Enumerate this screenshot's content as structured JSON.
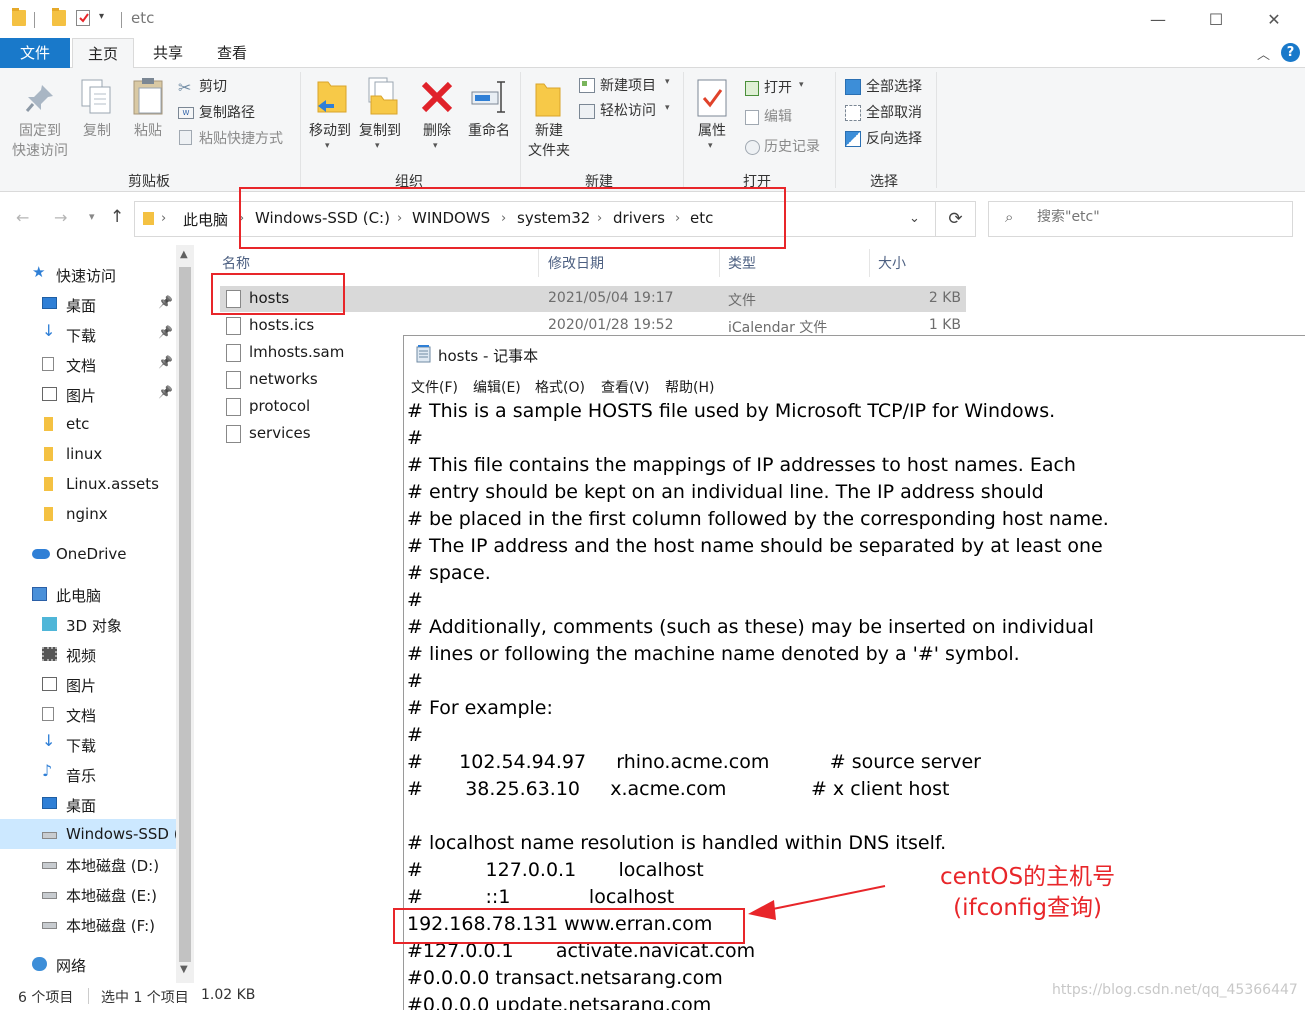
{
  "window": {
    "title": "etc",
    "minimize_glyph": "—",
    "maximize_glyph": "☐",
    "close_glyph": "✕"
  },
  "ribbon_tabs": [
    "文件",
    "主页",
    "共享",
    "查看"
  ],
  "ribbon": {
    "clipboard": {
      "label": "剪贴板",
      "pin_quick": [
        "固定到",
        "快速访问"
      ],
      "copy": "复制",
      "paste": "粘贴",
      "cut": "剪切",
      "copy_path": "复制路径",
      "paste_shortcut": "粘贴快捷方式"
    },
    "organize": {
      "label": "组织",
      "move_to": "移动到",
      "copy_to": "复制到",
      "delete": "删除",
      "rename": "重命名"
    },
    "new": {
      "label": "新建",
      "new_item": "新建项目",
      "easy_access": "轻松访问",
      "new_folder": [
        "新建",
        "文件夹"
      ]
    },
    "open": {
      "label": "打开",
      "properties": "属性",
      "open": "打开",
      "edit": "编辑",
      "history": "历史记录"
    },
    "select": {
      "label": "选择",
      "select_all": "全部选择",
      "select_none": "全部取消",
      "invert": "反向选择"
    }
  },
  "address": {
    "crumbs": [
      "此电脑",
      "Windows-SSD (C:)",
      "WINDOWS",
      "system32",
      "drivers",
      "etc"
    ],
    "search_placeholder": "搜索\"etc\""
  },
  "nav": {
    "items": [
      {
        "label": "快速访问",
        "icon": "star-icon",
        "indent": 0,
        "pinned": false
      },
      {
        "label": "桌面",
        "icon": "desktop-icon",
        "indent": 1,
        "pinned": true
      },
      {
        "label": "下载",
        "icon": "download-icon",
        "indent": 1,
        "pinned": true
      },
      {
        "label": "文档",
        "icon": "document-icon",
        "indent": 1,
        "pinned": true
      },
      {
        "label": "图片",
        "icon": "picture-icon",
        "indent": 1,
        "pinned": true
      },
      {
        "label": "etc",
        "icon": "folder-icon",
        "indent": 1,
        "pinned": false
      },
      {
        "label": "linux",
        "icon": "folder-icon",
        "indent": 1,
        "pinned": false
      },
      {
        "label": "Linux.assets",
        "icon": "folder-icon",
        "indent": 1,
        "pinned": false
      },
      {
        "label": "nginx",
        "icon": "folder-icon",
        "indent": 1,
        "pinned": false
      },
      {
        "label": "OneDrive",
        "icon": "cloud-icon",
        "indent": 0,
        "pinned": false
      },
      {
        "label": "此电脑",
        "icon": "computer-icon",
        "indent": 0,
        "pinned": false
      },
      {
        "label": "3D 对象",
        "icon": "cube-icon",
        "indent": 1,
        "pinned": false
      },
      {
        "label": "视频",
        "icon": "video-icon",
        "indent": 1,
        "pinned": false
      },
      {
        "label": "图片",
        "icon": "picture-icon",
        "indent": 1,
        "pinned": false
      },
      {
        "label": "文档",
        "icon": "document-icon",
        "indent": 1,
        "pinned": false
      },
      {
        "label": "下载",
        "icon": "download-icon",
        "indent": 1,
        "pinned": false
      },
      {
        "label": "音乐",
        "icon": "music-icon",
        "indent": 1,
        "pinned": false
      },
      {
        "label": "桌面",
        "icon": "desktop-icon",
        "indent": 1,
        "pinned": false
      },
      {
        "label": "Windows-SSD (",
        "icon": "drive-icon",
        "indent": 1,
        "pinned": false,
        "selected": true
      },
      {
        "label": "本地磁盘 (D:)",
        "icon": "drive-icon",
        "indent": 1,
        "pinned": false
      },
      {
        "label": "本地磁盘 (E:)",
        "icon": "drive-icon",
        "indent": 1,
        "pinned": false
      },
      {
        "label": "本地磁盘 (F:)",
        "icon": "drive-icon",
        "indent": 1,
        "pinned": false
      },
      {
        "label": "网络",
        "icon": "network-icon",
        "indent": 0,
        "pinned": false
      }
    ]
  },
  "filelist": {
    "columns": [
      "名称",
      "修改日期",
      "类型",
      "大小"
    ],
    "rows": [
      {
        "name": "hosts",
        "date": "2021/05/04 19:17",
        "type": "文件",
        "size": "2 KB"
      },
      {
        "name": "hosts.ics",
        "date": "2020/01/28 19:52",
        "type": "iCalendar 文件",
        "size": "1 KB"
      },
      {
        "name": "lmhosts.sam",
        "date": "",
        "type": "",
        "size": ""
      },
      {
        "name": "networks",
        "date": "",
        "type": "",
        "size": ""
      },
      {
        "name": "protocol",
        "date": "",
        "type": "",
        "size": ""
      },
      {
        "name": "services",
        "date": "",
        "type": "",
        "size": ""
      }
    ]
  },
  "status": {
    "count": "6 个项目",
    "selected": "选中 1 个项目",
    "size": "1.02 KB"
  },
  "notepad": {
    "title": "hosts - 记事本",
    "menu": [
      "文件(F)",
      "编辑(E)",
      "格式(O)",
      "查看(V)",
      "帮助(H)"
    ],
    "content": "# This is a sample HOSTS file used by Microsoft TCP/IP for Windows.\n#\n# This file contains the mappings of IP addresses to host names. Each\n# entry should be kept on an individual line. The IP address should\n# be placed in the first column followed by the corresponding host name.\n# The IP address and the host name should be separated by at least one\n# space.\n#\n# Additionally, comments (such as these) may be inserted on individual\n# lines or following the machine name denoted by a '#' symbol.\n#\n# For example:\n#\n#      102.54.94.97     rhino.acme.com          # source server\n#       38.25.63.10     x.acme.com              # x client host\n\n# localhost name resolution is handled within DNS itself.\n#\t     127.0.0.1       localhost\n#\t     ::1             localhost\n192.168.78.131 www.erran.com\n#127.0.0.1       activate.navicat.com\n#0.0.0.0 transact.netsarang.com\n#0.0.0.0 update.netsarang.com"
  },
  "annotation": {
    "text": "centOS的主机号\n(ifconfig查询)",
    "color": "#e8262a"
  },
  "watermark": "https://blog.csdn.net/qq_45366447",
  "colors": {
    "accent": "#1979ca",
    "annotation_red": "#e8262a",
    "selection": "#cce8ff"
  }
}
